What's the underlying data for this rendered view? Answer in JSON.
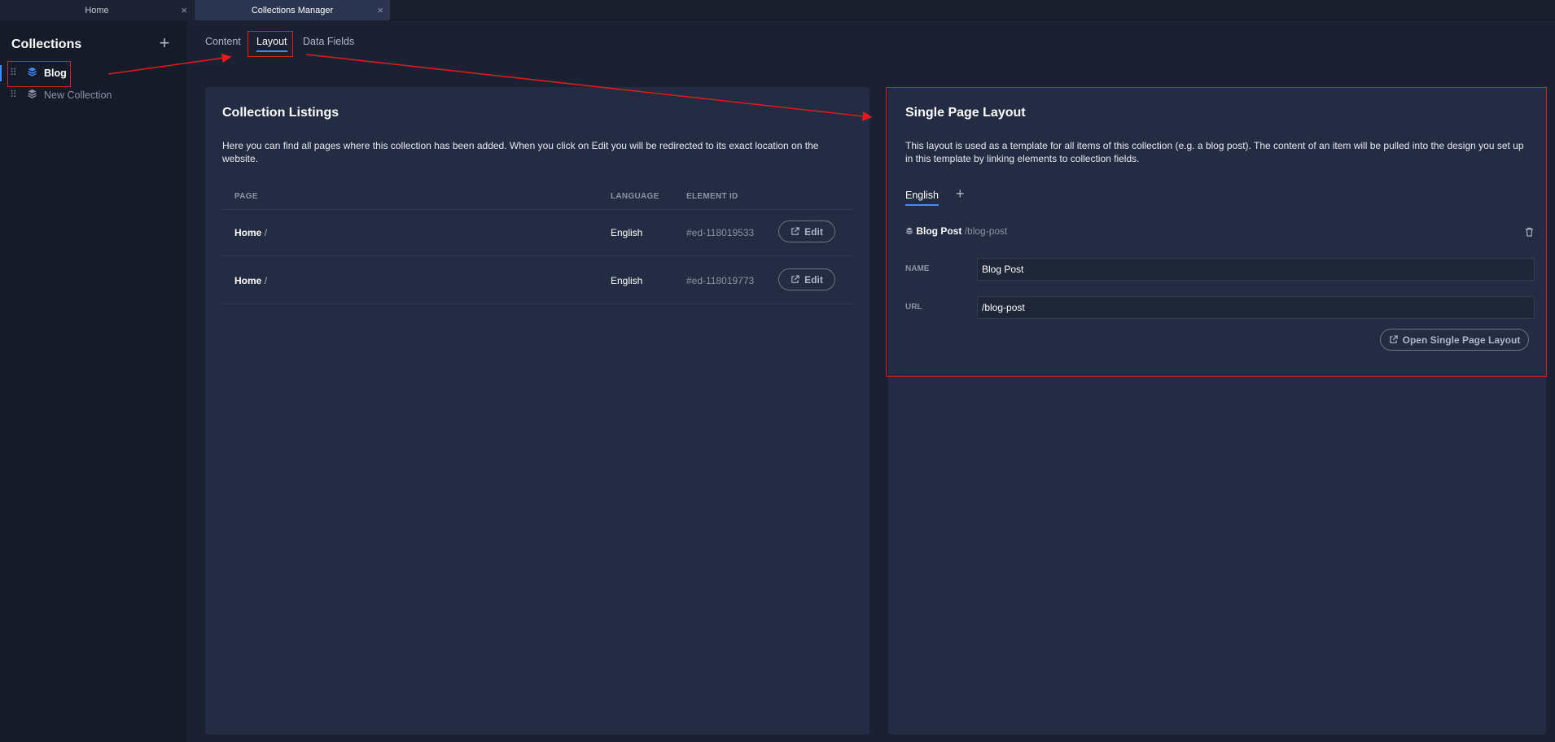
{
  "window_tabs": [
    {
      "label": "Home"
    },
    {
      "label": "Collections Manager"
    }
  ],
  "sidebar": {
    "title": "Collections",
    "items": [
      {
        "label": "Blog",
        "active": true
      },
      {
        "label": "New Collection",
        "active": false
      }
    ]
  },
  "main_tabs": [
    {
      "label": "Content"
    },
    {
      "label": "Layout",
      "active": true
    },
    {
      "label": "Data Fields"
    }
  ],
  "listings": {
    "title": "Collection Listings",
    "description": "Here you can find all pages where this collection has been added. When you click on Edit you will be redirected to its exact location on the website.",
    "columns": [
      "PAGE",
      "LANGUAGE",
      "ELEMENT ID"
    ],
    "rows": [
      {
        "page": "Home",
        "sep": "/",
        "language": "English",
        "element_id": "#ed-118019533",
        "action": "Edit"
      },
      {
        "page": "Home",
        "sep": "/",
        "language": "English",
        "element_id": "#ed-118019773",
        "action": "Edit"
      }
    ]
  },
  "single_page": {
    "title": "Single Page Layout",
    "description": "This layout is used as a template for all items of this collection (e.g. a blog post). The content of an item will be pulled into the design you set up in this template by linking elements to collection fields.",
    "language_tab": "English",
    "item_name": "Blog Post",
    "item_path": "/blog-post",
    "name_label": "NAME",
    "name_value": "Blog Post",
    "url_label": "URL",
    "url_value": "/blog-post",
    "open_button": "Open Single Page Layout"
  },
  "colors": {
    "accent": "#3f8cff",
    "annotation": "#e31b1b",
    "panel": "#232c42",
    "background": "#1b2133"
  }
}
